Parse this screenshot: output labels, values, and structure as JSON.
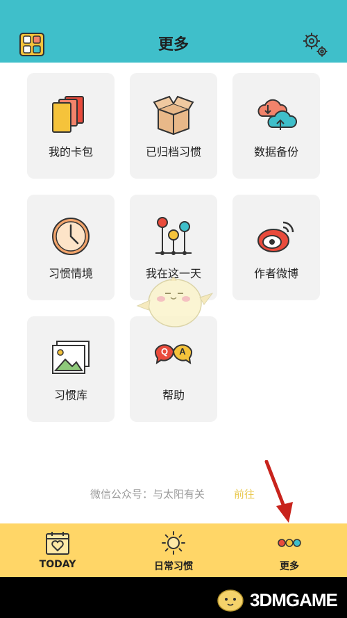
{
  "header": {
    "title": "更多"
  },
  "cards": [
    {
      "label": "我的卡包"
    },
    {
      "label": "已归档习惯"
    },
    {
      "label": "数据备份"
    },
    {
      "label": "习惯情境"
    },
    {
      "label": "我在这一天"
    },
    {
      "label": "作者微博"
    },
    {
      "label": "习惯库"
    },
    {
      "label": "帮助"
    }
  ],
  "footer_note": {
    "text": "微信公众号：与太阳有关",
    "link": "前往"
  },
  "tabs": [
    {
      "label": "TODAY"
    },
    {
      "label": "日常习惯"
    },
    {
      "label": "更多"
    }
  ],
  "watermark": {
    "text": "3DMGAME"
  },
  "colors": {
    "header_bg": "#3fbfca",
    "tabbar_bg": "#ffd667",
    "card_bg": "#f2f2f2",
    "link": "#e9c84d"
  }
}
